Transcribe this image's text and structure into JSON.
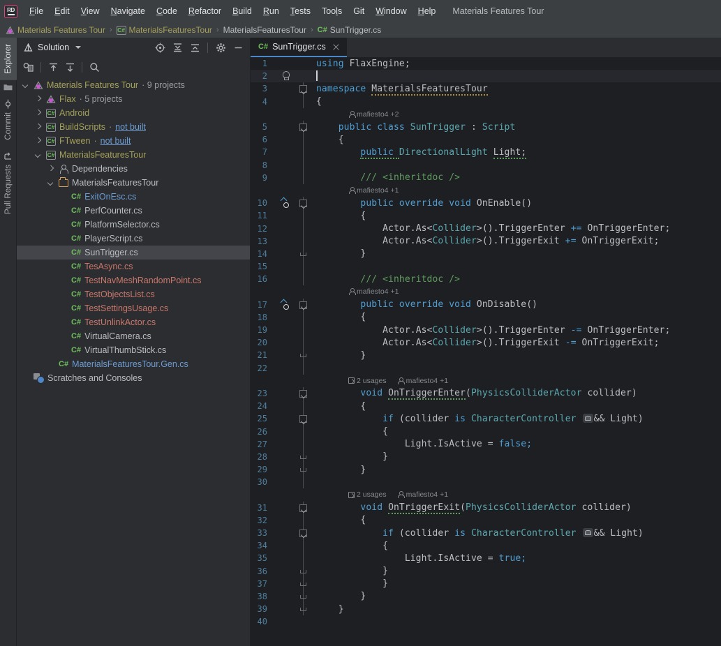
{
  "window": {
    "project_name": "Materials Features Tour"
  },
  "menubar": {
    "logo": "rider-logo-icon",
    "items": [
      {
        "label": "File",
        "mnemonic": "F"
      },
      {
        "label": "Edit",
        "mnemonic": "E"
      },
      {
        "label": "View",
        "mnemonic": "V"
      },
      {
        "label": "Navigate",
        "mnemonic": "N"
      },
      {
        "label": "Code",
        "mnemonic": "C"
      },
      {
        "label": "Refactor",
        "mnemonic": "R"
      },
      {
        "label": "Build",
        "mnemonic": "B"
      },
      {
        "label": "Run",
        "mnemonic": "R"
      },
      {
        "label": "Tests",
        "mnemonic": "T"
      },
      {
        "label": "Tools",
        "mnemonic": "l"
      },
      {
        "label": "Git",
        "mnemonic": ""
      },
      {
        "label": "Window",
        "mnemonic": "W"
      },
      {
        "label": "Help",
        "mnemonic": "H"
      }
    ]
  },
  "breadcrumb": {
    "items": [
      {
        "label": "Materials Features Tour",
        "icon": "flax-solution-icon",
        "color": "olive"
      },
      {
        "label": "MaterialsFeaturesTour",
        "icon": "csharp-project-icon",
        "color": "olive"
      },
      {
        "label": "MaterialsFeaturesTour",
        "icon": "",
        "color": "grey"
      },
      {
        "label": "SunTrigger.cs",
        "icon": "csharp-file-icon",
        "color": "grey"
      }
    ],
    "separator": "›"
  },
  "tool_stripe": {
    "buttons": [
      {
        "label": "Explorer",
        "icon": "folder-icon",
        "active": true
      },
      {
        "label": "Commit",
        "icon": "commit-icon",
        "active": false
      },
      {
        "label": "Pull Requests",
        "icon": "pull-request-icon",
        "active": false
      }
    ]
  },
  "solution_panel": {
    "title": "Solution",
    "title_icon": "flax-icon",
    "dropdown_icon": "chevron-down-icon",
    "header_tools": [
      {
        "name": "locate-icon",
        "title": "Select Opened File"
      },
      {
        "name": "expand-all-icon",
        "title": "Expand All"
      },
      {
        "name": "collapse-all-icon",
        "title": "Collapse All"
      },
      {
        "name": "gear-icon",
        "title": "Options"
      },
      {
        "name": "minimize-icon",
        "title": "Hide"
      }
    ],
    "secondary_tools": [
      {
        "name": "solution-config-icon",
        "title": "Solution Configuration"
      },
      {
        "name": "upload-icon",
        "title": "Push"
      },
      {
        "name": "download-icon",
        "title": "Pull"
      },
      {
        "name": "search-icon",
        "title": "Search"
      }
    ],
    "tree": [
      {
        "depth": 0,
        "twisty": "down",
        "icon": "flax-solution-icon",
        "label": "Materials Features Tour",
        "meta": " · 9 projects",
        "color": "olive",
        "selected": false
      },
      {
        "depth": 1,
        "twisty": "right",
        "icon": "flax-project-icon",
        "label": "Flax",
        "meta": " · 5 projects",
        "color": "olive",
        "selected": false
      },
      {
        "depth": 1,
        "twisty": "right",
        "icon": "csharp-project-icon",
        "label": "Android",
        "meta": "",
        "color": "olive",
        "selected": false
      },
      {
        "depth": 1,
        "twisty": "right",
        "icon": "csharp-project-icon",
        "label": "BuildScripts",
        "meta": " · ",
        "link": "not built",
        "color": "olive",
        "selected": false
      },
      {
        "depth": 1,
        "twisty": "right",
        "icon": "csharp-project-icon",
        "label": "FTween",
        "meta": " · ",
        "link": "not built",
        "color": "olive",
        "selected": false
      },
      {
        "depth": 1,
        "twisty": "down",
        "icon": "csharp-project-icon",
        "label": "MaterialsFeaturesTour",
        "meta": "",
        "color": "olive",
        "selected": false
      },
      {
        "depth": 2,
        "twisty": "right",
        "icon": "dependencies-icon",
        "label": "Dependencies",
        "meta": "",
        "color": "grey",
        "selected": false
      },
      {
        "depth": 2,
        "twisty": "down",
        "icon": "folder-icon",
        "label": "MaterialsFeaturesTour",
        "meta": "",
        "color": "grey",
        "selected": false
      },
      {
        "depth": 3,
        "twisty": "none",
        "icon": "csharp-file-icon",
        "label": "ExitOnEsc.cs",
        "meta": "",
        "color": "blue",
        "selected": false
      },
      {
        "depth": 3,
        "twisty": "none",
        "icon": "csharp-file-icon",
        "label": "PerfCounter.cs",
        "meta": "",
        "color": "grey",
        "selected": false
      },
      {
        "depth": 3,
        "twisty": "none",
        "icon": "csharp-file-icon",
        "label": "PlatformSelector.cs",
        "meta": "",
        "color": "grey",
        "selected": false
      },
      {
        "depth": 3,
        "twisty": "none",
        "icon": "csharp-file-icon",
        "label": "PlayerScript.cs",
        "meta": "",
        "color": "grey",
        "selected": false
      },
      {
        "depth": 3,
        "twisty": "none",
        "icon": "csharp-file-icon",
        "label": "SunTrigger.cs",
        "meta": "",
        "color": "grey",
        "selected": true
      },
      {
        "depth": 3,
        "twisty": "none",
        "icon": "csharp-file-icon",
        "label": "TesAsync.cs",
        "meta": "",
        "color": "red",
        "selected": false
      },
      {
        "depth": 3,
        "twisty": "none",
        "icon": "csharp-file-icon",
        "label": "TestNavMeshRandomPoint.cs",
        "meta": "",
        "color": "red",
        "selected": false
      },
      {
        "depth": 3,
        "twisty": "none",
        "icon": "csharp-file-icon",
        "label": "TestObjectsList.cs",
        "meta": "",
        "color": "red",
        "selected": false
      },
      {
        "depth": 3,
        "twisty": "none",
        "icon": "csharp-file-icon",
        "label": "TestSettingsUsage.cs",
        "meta": "",
        "color": "red",
        "selected": false
      },
      {
        "depth": 3,
        "twisty": "none",
        "icon": "csharp-file-icon",
        "label": "TestUnlinkActor.cs",
        "meta": "",
        "color": "red",
        "selected": false
      },
      {
        "depth": 3,
        "twisty": "none",
        "icon": "csharp-file-icon",
        "label": "VirtualCamera.cs",
        "meta": "",
        "color": "grey",
        "selected": false
      },
      {
        "depth": 3,
        "twisty": "none",
        "icon": "csharp-file-icon",
        "label": "VirtualThumbStick.cs",
        "meta": "",
        "color": "grey",
        "selected": false
      },
      {
        "depth": 2,
        "twisty": "none",
        "icon": "csharp-file-icon",
        "label": "MaterialsFeaturesTour.Gen.cs",
        "meta": "",
        "color": "blue",
        "selected": false
      },
      {
        "depth": 0,
        "twisty": "none",
        "icon": "scratches-icon",
        "label": "Scratches and Consoles",
        "meta": "",
        "color": "grey",
        "selected": false
      }
    ]
  },
  "editor": {
    "tab": {
      "label": "SunTrigger.cs",
      "icon": "csharp-file-icon",
      "close_icon": "close-icon",
      "active": true
    },
    "current_line": 2,
    "total_lines": 40,
    "annotations": {
      "usages_2": "2 usages",
      "author_plus2": "mafiesto4 +2",
      "author_plus1": "mafiesto4 +1"
    },
    "code_lines": [
      {
        "n": 1,
        "indent": 0,
        "tokens": [
          {
            "t": "using ",
            "c": "kw2"
          },
          {
            "t": "FlaxEngine;",
            "c": "plain"
          }
        ]
      },
      {
        "n": 2,
        "indent": 0,
        "gutter": "bulb",
        "caret": true,
        "tokens": []
      },
      {
        "n": 3,
        "indent": 0,
        "fold": "start",
        "tokens": [
          {
            "t": "namespace ",
            "c": "kw2"
          },
          {
            "t": "MaterialsFeaturesTour",
            "c": "plain",
            "squiggle": "yellow"
          }
        ]
      },
      {
        "n": 4,
        "indent": 0,
        "tokens": [
          {
            "t": "{",
            "c": "plain"
          }
        ]
      },
      {
        "n": 5,
        "indent": 1,
        "fold": "start",
        "ann": "author_plus2",
        "tokens": [
          {
            "t": "public class ",
            "c": "kw2"
          },
          {
            "t": "SunTrigger",
            "c": "type"
          },
          {
            "t": " : ",
            "c": "plain"
          },
          {
            "t": "Script",
            "c": "type"
          }
        ]
      },
      {
        "n": 6,
        "indent": 1,
        "tokens": [
          {
            "t": "{",
            "c": "plain"
          }
        ]
      },
      {
        "n": 7,
        "indent": 2,
        "tokens": [
          {
            "t": "public ",
            "c": "kw2",
            "squiggle": "green"
          },
          {
            "t": "DirectionalLight",
            "c": "type"
          },
          {
            "t": " ",
            "c": "plain"
          },
          {
            "t": "Light;",
            "c": "plain",
            "squiggle": "green"
          }
        ]
      },
      {
        "n": 8,
        "indent": 2,
        "tokens": []
      },
      {
        "n": 9,
        "indent": 2,
        "tokens": [
          {
            "t": "/// <inheritdoc />",
            "c": "cmt"
          }
        ]
      },
      {
        "n": 10,
        "indent": 2,
        "gutter": "override",
        "fold": "start",
        "ann": "author_plus1",
        "tokens": [
          {
            "t": "public override void ",
            "c": "kw2"
          },
          {
            "t": "OnEnable()",
            "c": "plain"
          }
        ]
      },
      {
        "n": 11,
        "indent": 2,
        "tokens": [
          {
            "t": "{",
            "c": "plain"
          }
        ]
      },
      {
        "n": 12,
        "indent": 3,
        "tokens": [
          {
            "t": "Actor",
            "c": "plain"
          },
          {
            "t": ".As<",
            "c": "plain"
          },
          {
            "t": "Collider",
            "c": "type"
          },
          {
            "t": ">().",
            "c": "plain"
          },
          {
            "t": "TriggerEnter",
            "c": "plain"
          },
          {
            "t": " ",
            "c": "plain"
          },
          {
            "t": "+=",
            "c": "kw2"
          },
          {
            "t": " OnTriggerEnter;",
            "c": "plain"
          }
        ]
      },
      {
        "n": 13,
        "indent": 3,
        "tokens": [
          {
            "t": "Actor",
            "c": "plain"
          },
          {
            "t": ".As<",
            "c": "plain"
          },
          {
            "t": "Collider",
            "c": "type"
          },
          {
            "t": ">().",
            "c": "plain"
          },
          {
            "t": "TriggerExit",
            "c": "plain"
          },
          {
            "t": " ",
            "c": "plain"
          },
          {
            "t": "+=",
            "c": "kw2"
          },
          {
            "t": " OnTriggerExit;",
            "c": "plain"
          }
        ]
      },
      {
        "n": 14,
        "indent": 2,
        "fold": "end",
        "tokens": [
          {
            "t": "}",
            "c": "plain"
          }
        ]
      },
      {
        "n": 15,
        "indent": 2,
        "tokens": []
      },
      {
        "n": 16,
        "indent": 2,
        "tokens": [
          {
            "t": "/// <inheritdoc />",
            "c": "cmt"
          }
        ]
      },
      {
        "n": 17,
        "indent": 2,
        "gutter": "override",
        "fold": "start",
        "ann": "author_plus1",
        "tokens": [
          {
            "t": "public override void ",
            "c": "kw2"
          },
          {
            "t": "OnDisable()",
            "c": "plain"
          }
        ]
      },
      {
        "n": 18,
        "indent": 2,
        "tokens": [
          {
            "t": "{",
            "c": "plain"
          }
        ]
      },
      {
        "n": 19,
        "indent": 3,
        "tokens": [
          {
            "t": "Actor",
            "c": "plain"
          },
          {
            "t": ".As<",
            "c": "plain"
          },
          {
            "t": "Collider",
            "c": "type"
          },
          {
            "t": ">().",
            "c": "plain"
          },
          {
            "t": "TriggerEnter",
            "c": "plain"
          },
          {
            "t": " ",
            "c": "plain"
          },
          {
            "t": "-=",
            "c": "kw2"
          },
          {
            "t": " OnTriggerEnter;",
            "c": "plain"
          }
        ]
      },
      {
        "n": 20,
        "indent": 3,
        "tokens": [
          {
            "t": "Actor",
            "c": "plain"
          },
          {
            "t": ".As<",
            "c": "plain"
          },
          {
            "t": "Collider",
            "c": "type"
          },
          {
            "t": ">().",
            "c": "plain"
          },
          {
            "t": "TriggerExit",
            "c": "plain"
          },
          {
            "t": " ",
            "c": "plain"
          },
          {
            "t": "-=",
            "c": "kw2"
          },
          {
            "t": " OnTriggerExit;",
            "c": "plain"
          }
        ]
      },
      {
        "n": 21,
        "indent": 2,
        "fold": "end",
        "tokens": [
          {
            "t": "}",
            "c": "plain"
          }
        ]
      },
      {
        "n": 22,
        "indent": 2,
        "tokens": []
      },
      {
        "n": 23,
        "indent": 2,
        "fold": "start",
        "ann": "usages_author1",
        "tokens": [
          {
            "t": "void ",
            "c": "kw2"
          },
          {
            "t": "OnTriggerEnter",
            "c": "plain",
            "squiggle": "green"
          },
          {
            "t": "(",
            "c": "plain"
          },
          {
            "t": "PhysicsColliderActor",
            "c": "type"
          },
          {
            "t": " collider)",
            "c": "plain"
          }
        ]
      },
      {
        "n": 24,
        "indent": 2,
        "tokens": [
          {
            "t": "{",
            "c": "plain"
          }
        ]
      },
      {
        "n": 25,
        "indent": 3,
        "fold": "start",
        "tokens": [
          {
            "t": "if ",
            "c": "kw2"
          },
          {
            "t": "(collider ",
            "c": "plain"
          },
          {
            "t": "is ",
            "c": "kw2"
          },
          {
            "t": "CharacterController",
            "c": "type"
          },
          {
            "t": " ",
            "c": "plain"
          },
          {
            "t": "__BADGE__",
            "c": "badge"
          },
          {
            "t": "&& Light)",
            "c": "plain"
          }
        ]
      },
      {
        "n": 26,
        "indent": 3,
        "tokens": [
          {
            "t": "{",
            "c": "plain"
          }
        ]
      },
      {
        "n": 27,
        "indent": 4,
        "tokens": [
          {
            "t": "Light",
            "c": "plain"
          },
          {
            "t": ".IsActive = ",
            "c": "plain"
          },
          {
            "t": "false;",
            "c": "kw2"
          }
        ]
      },
      {
        "n": 28,
        "indent": 3,
        "fold": "end",
        "tokens": [
          {
            "t": "}",
            "c": "plain"
          }
        ]
      },
      {
        "n": 29,
        "indent": 2,
        "fold": "end",
        "tokens": [
          {
            "t": "}",
            "c": "plain"
          }
        ]
      },
      {
        "n": 30,
        "indent": 2,
        "tokens": []
      },
      {
        "n": 31,
        "indent": 2,
        "fold": "start",
        "ann": "usages_author1",
        "tokens": [
          {
            "t": "void ",
            "c": "kw2"
          },
          {
            "t": "OnTriggerExit",
            "c": "plain",
            "squiggle": "green"
          },
          {
            "t": "(",
            "c": "plain"
          },
          {
            "t": "PhysicsColliderActor",
            "c": "type"
          },
          {
            "t": " collider)",
            "c": "plain"
          }
        ]
      },
      {
        "n": 32,
        "indent": 2,
        "tokens": [
          {
            "t": "{",
            "c": "plain"
          }
        ]
      },
      {
        "n": 33,
        "indent": 3,
        "fold": "start",
        "tokens": [
          {
            "t": "if ",
            "c": "kw2"
          },
          {
            "t": "(collider ",
            "c": "plain"
          },
          {
            "t": "is ",
            "c": "kw2"
          },
          {
            "t": "CharacterController",
            "c": "type"
          },
          {
            "t": " ",
            "c": "plain"
          },
          {
            "t": "__BADGE__",
            "c": "badge"
          },
          {
            "t": "&& Light)",
            "c": "plain"
          }
        ]
      },
      {
        "n": 34,
        "indent": 3,
        "tokens": [
          {
            "t": "{",
            "c": "plain"
          }
        ]
      },
      {
        "n": 35,
        "indent": 4,
        "tokens": [
          {
            "t": "Light",
            "c": "plain"
          },
          {
            "t": ".IsActive = ",
            "c": "plain"
          },
          {
            "t": "true;",
            "c": "kw2"
          }
        ]
      },
      {
        "n": 36,
        "indent": 3,
        "fold": "end",
        "tokens": [
          {
            "t": "}",
            "c": "plain"
          }
        ]
      },
      {
        "n": 37,
        "indent": 3,
        "fold": "end",
        "tokens": [
          {
            "t": "}",
            "c": "plain"
          }
        ]
      },
      {
        "n": 38,
        "indent": 2,
        "fold": "end",
        "tokens": [
          {
            "t": "}",
            "c": "plain"
          }
        ]
      },
      {
        "n": 39,
        "indent": 1,
        "fold": "end",
        "tokens": [
          {
            "t": "}",
            "c": "plain"
          }
        ]
      },
      {
        "n": 40,
        "indent": 0,
        "tokens": []
      }
    ]
  },
  "colors": {
    "bg_chrome": "#3c3f41",
    "bg_panel": "#2b2d30",
    "bg_editor": "#1e1f22",
    "accent_tab": "#4a88c7",
    "selection": "#43454a",
    "keyword": "#4f9fd4",
    "type": "#5ba8b0",
    "comment": "#5f9e5f",
    "text": "#bcbec4",
    "linenum": "#4f7f9e",
    "olive": "#a5a15a",
    "blue_file": "#6c9cd2",
    "red_file": "#c9776b"
  }
}
